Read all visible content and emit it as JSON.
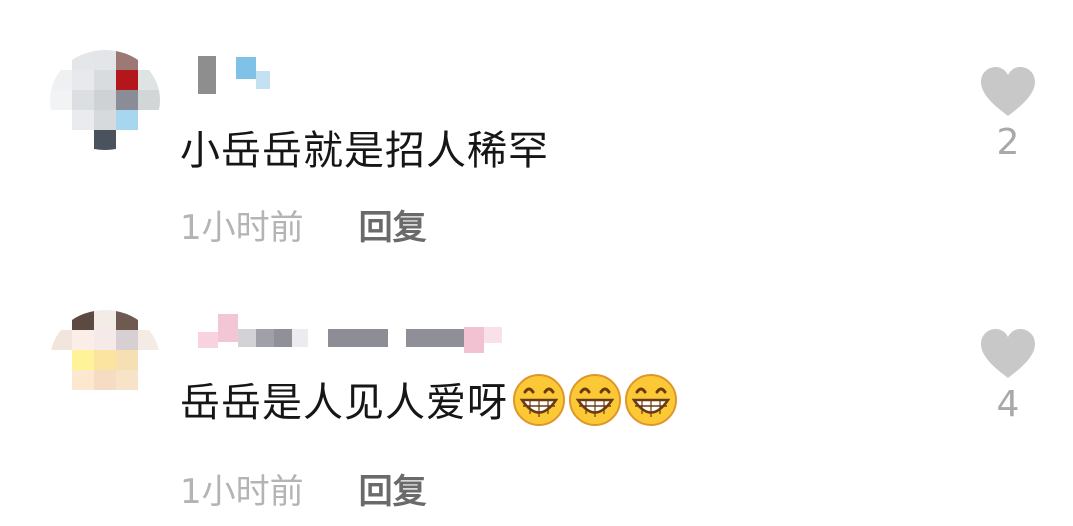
{
  "comments": [
    {
      "text": "小岳岳就是招人稀罕",
      "emojis": [],
      "time": "1小时前",
      "reply_label": "回复",
      "like_count": "2"
    },
    {
      "text": "岳岳是人见人爱呀",
      "emojis": [
        "grinning-face",
        "grinning-face",
        "grinning-face"
      ],
      "time": "1小时前",
      "reply_label": "回复",
      "like_count": "4"
    }
  ],
  "colors": {
    "text": "#161616",
    "time": "#b4b4b4",
    "reply": "#6a6a6a",
    "heart": "#c8c8c8",
    "count": "#a9a9a9"
  }
}
